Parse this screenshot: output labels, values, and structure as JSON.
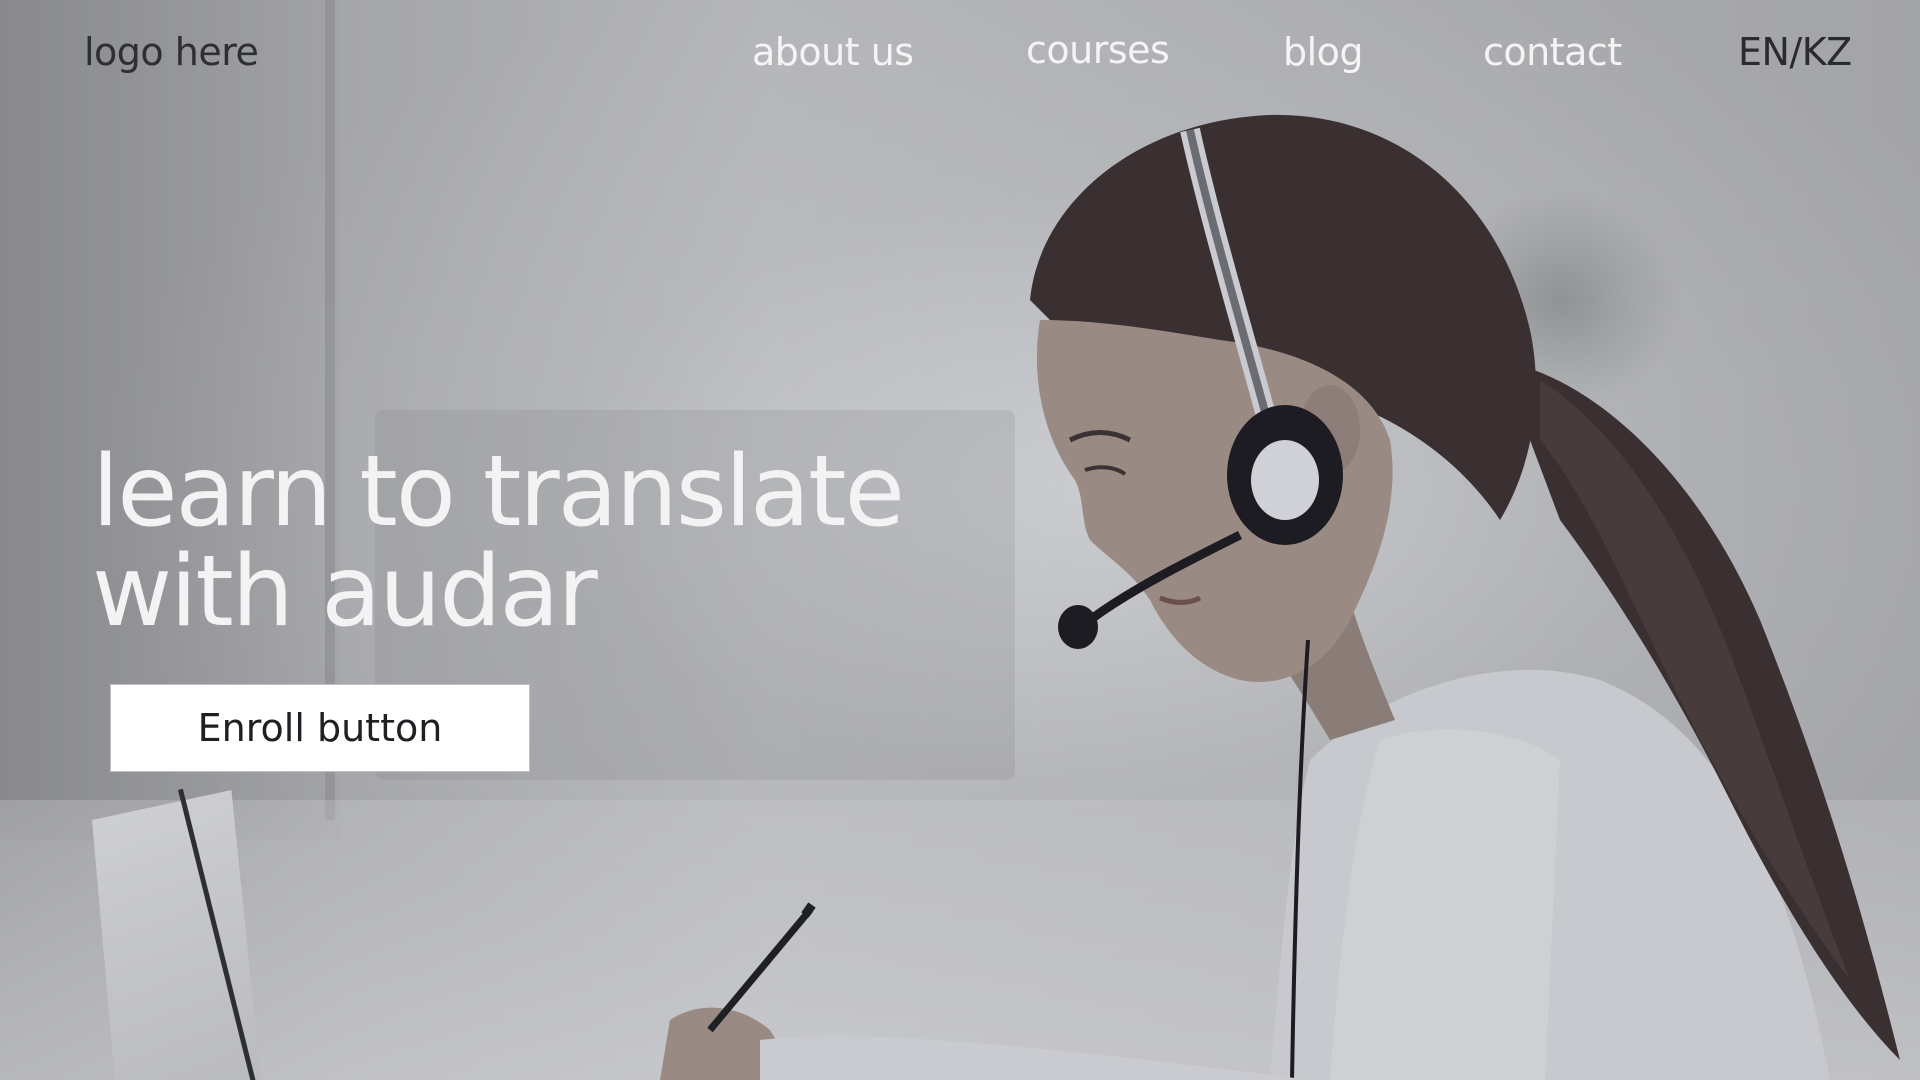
{
  "header": {
    "logo_text": "logo here",
    "nav": {
      "about": "about us",
      "courses": "courses",
      "blog": "blog",
      "contact": "contact",
      "language": "EN/KZ"
    }
  },
  "hero": {
    "headline_line1": "learn to translate",
    "headline_line2": "with audar",
    "cta_label": "Enroll button",
    "image": "photo-woman-with-headset-writing-notes"
  },
  "colors": {
    "nav_text": "#f4f4f5",
    "logo_text": "#2e2f33",
    "headline_text": "#f3f3f4",
    "button_bg": "#ffffff",
    "button_text": "#1f2024"
  }
}
